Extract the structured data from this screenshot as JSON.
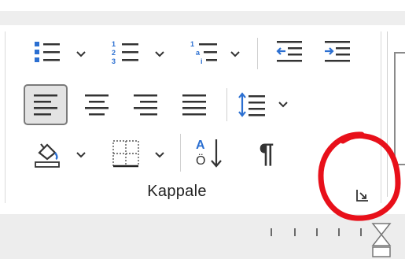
{
  "group": {
    "label": "Kappale",
    "accent_color": "#2b6fd1",
    "annotation_color": "#e8101a"
  },
  "buttons": {
    "row1": [
      {
        "name": "bullets-button",
        "icon": "bullets-icon",
        "has_dropdown": true
      },
      {
        "name": "numbering-button",
        "icon": "numbering-icon",
        "has_dropdown": true
      },
      {
        "name": "multilevel-list-button",
        "icon": "multilevel-list-icon",
        "has_dropdown": true
      },
      {
        "name": "decrease-indent-button",
        "icon": "decrease-indent-icon",
        "has_dropdown": false
      },
      {
        "name": "increase-indent-button",
        "icon": "increase-indent-icon",
        "has_dropdown": false
      }
    ],
    "row2": [
      {
        "name": "align-left-button",
        "icon": "align-left-icon",
        "active": true
      },
      {
        "name": "center-button",
        "icon": "align-center-icon",
        "active": false
      },
      {
        "name": "align-right-button",
        "icon": "align-right-icon",
        "active": false
      },
      {
        "name": "justify-button",
        "icon": "justify-icon",
        "active": false
      },
      {
        "name": "line-spacing-button",
        "icon": "line-spacing-icon",
        "has_dropdown": true
      }
    ],
    "row3": [
      {
        "name": "shading-button",
        "icon": "paint-bucket-icon",
        "has_dropdown": true
      },
      {
        "name": "borders-button",
        "icon": "borders-icon",
        "has_dropdown": true
      },
      {
        "name": "sort-button",
        "icon": "sort-icon",
        "has_dropdown": false
      },
      {
        "name": "show-hide-marks-button",
        "icon": "pilcrow-icon",
        "has_dropdown": false
      }
    ]
  },
  "sort_icon_letters": {
    "top": "A",
    "bottom": "Ö"
  },
  "pilcrow_glyph": "¶",
  "launcher": {
    "name": "paragraph-settings-launcher",
    "icon": "dialog-launcher-icon"
  }
}
